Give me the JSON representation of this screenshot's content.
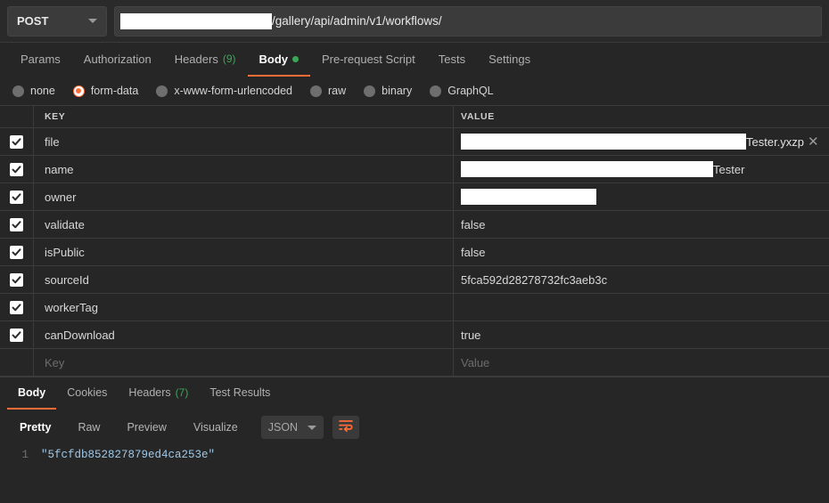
{
  "urlbar": {
    "method": "POST",
    "url_redacted": true,
    "url_path": "/gallery/api/admin/v1/workflows/"
  },
  "request_tabs": [
    {
      "label": "Params",
      "active": false
    },
    {
      "label": "Authorization",
      "active": false
    },
    {
      "label": "Headers",
      "count": "(9)",
      "active": false
    },
    {
      "label": "Body",
      "dot": true,
      "active": true
    },
    {
      "label": "Pre-request Script",
      "active": false
    },
    {
      "label": "Tests",
      "active": false
    },
    {
      "label": "Settings",
      "active": false
    }
  ],
  "body_types": [
    {
      "label": "none",
      "selected": false
    },
    {
      "label": "form-data",
      "selected": true
    },
    {
      "label": "x-www-form-urlencoded",
      "selected": false
    },
    {
      "label": "raw",
      "selected": false
    },
    {
      "label": "binary",
      "selected": false
    },
    {
      "label": "GraphQL",
      "selected": false
    }
  ],
  "table": {
    "headers": {
      "key": "KEY",
      "value": "VALUE"
    },
    "placeholders": {
      "key": "Key",
      "value": "Value"
    },
    "rows": [
      {
        "checked": true,
        "key": "file",
        "value": "Tester.yxzp",
        "redacted": true,
        "redact_width": 320,
        "is_file": true
      },
      {
        "checked": true,
        "key": "name",
        "value": "Tester",
        "redacted": true,
        "redact_width": 283
      },
      {
        "checked": true,
        "key": "owner",
        "value": "",
        "redacted": true,
        "redact_width": 152
      },
      {
        "checked": true,
        "key": "validate",
        "value": "false",
        "redacted": false
      },
      {
        "checked": true,
        "key": "isPublic",
        "value": "false",
        "redacted": false
      },
      {
        "checked": true,
        "key": "sourceId",
        "value": "5fca592d28278732fc3aeb3c",
        "redacted": false
      },
      {
        "checked": true,
        "key": "workerTag",
        "value": "",
        "redacted": false
      },
      {
        "checked": true,
        "key": "canDownload",
        "value": "true",
        "redacted": false
      }
    ]
  },
  "response": {
    "tabs": [
      {
        "label": "Body",
        "active": true
      },
      {
        "label": "Cookies",
        "active": false
      },
      {
        "label": "Headers",
        "count": "(7)",
        "active": false
      },
      {
        "label": "Test Results",
        "active": false
      }
    ],
    "view_tabs": [
      {
        "label": "Pretty",
        "active": true
      },
      {
        "label": "Raw",
        "active": false
      },
      {
        "label": "Preview",
        "active": false
      },
      {
        "label": "Visualize",
        "active": false
      }
    ],
    "format": "JSON",
    "code": [
      {
        "line_number": "1",
        "text": "\"5fcfdb852827879ed4ca253e\""
      }
    ]
  },
  "colors": {
    "accent": "#ff6c37",
    "green": "#3aa757",
    "string": "#9fc9e8"
  }
}
